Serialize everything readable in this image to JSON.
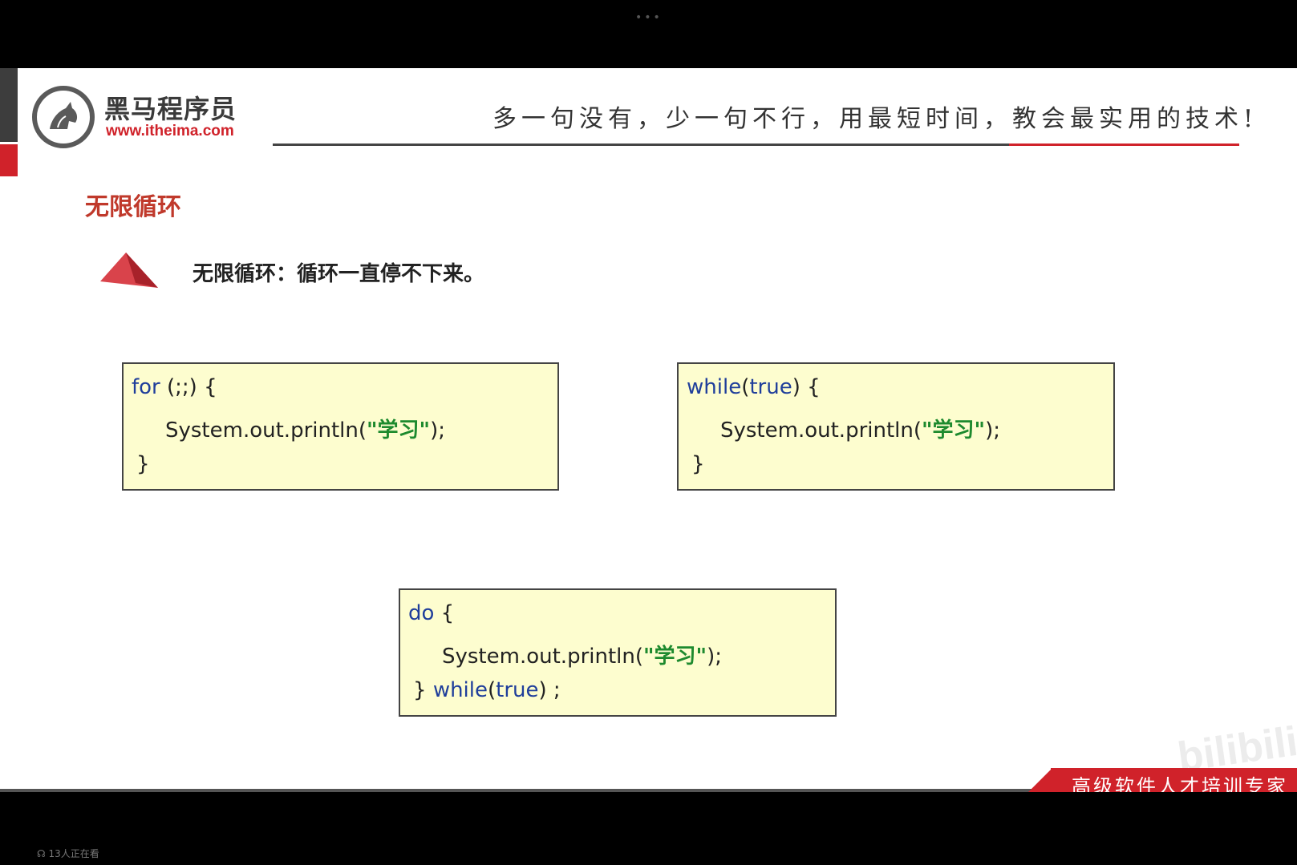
{
  "header": {
    "logo_name": "黑马程序员",
    "logo_url": "www.itheima.com",
    "slogan": "多一句没有，少一句不行，用最短时间，教会最实用的技术!"
  },
  "section": {
    "title": "无限循环",
    "bullet": "无限循环：循环一直停不下来。"
  },
  "code_for": {
    "kw": "for",
    "rest": " (;;) {",
    "stmt": "System.out.println(",
    "str": "\"学习\"",
    "end": ");",
    "close": "}"
  },
  "code_while": {
    "kw": "while",
    "paren_open": "(",
    "cond": "true",
    "rest": ") {",
    "stmt": "System.out.println(",
    "str": "\"学习\"",
    "end": ");",
    "close": "}"
  },
  "code_do": {
    "kw": "do",
    "rest": " {",
    "stmt": "System.out.println(",
    "str": "\"学习\"",
    "end": ");",
    "close": "} ",
    "while_kw": "while",
    "paren_open": "(",
    "cond": "true",
    "tail": ") ;"
  },
  "footer": {
    "badge": "高级软件人才培训专家",
    "watermark": "bilibili",
    "viewers": "13人正在看"
  },
  "colors": {
    "accent_red": "#d0222a",
    "keyword_blue": "#1f3e9b",
    "string_green": "#1d8a2e",
    "code_bg": "#fdfdcf"
  }
}
